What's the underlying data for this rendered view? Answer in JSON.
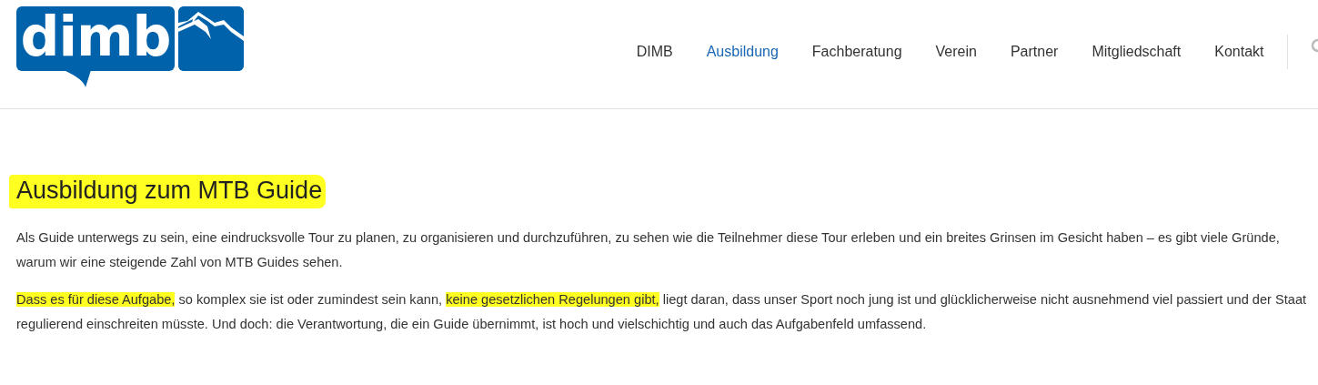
{
  "logo": {
    "text": "dimb"
  },
  "nav": [
    {
      "label": "DIMB",
      "selected": false
    },
    {
      "label": "Ausbildung",
      "selected": true
    },
    {
      "label": "Fachberatung",
      "selected": false
    },
    {
      "label": "Verein",
      "selected": false
    },
    {
      "label": "Partner",
      "selected": false
    },
    {
      "label": "Mitgliedschaft",
      "selected": false
    },
    {
      "label": "Kontakt",
      "selected": false
    }
  ],
  "heading": {
    "text": "Ausbildung zum MTB Guide",
    "highlighted": true
  },
  "paragraphs": [
    [
      {
        "text": "Als Guide unterwegs zu sein, eine eindrucksvolle Tour zu planen, zu organisieren und durchzuführen, zu sehen wie die Teilnehmer diese Tour erleben und ein breites Grinsen im Gesicht haben – es gibt viele Gründe, warum wir eine steigende Zahl von MTB Guides sehen.",
        "highlighted": false
      }
    ],
    [
      {
        "text": "Dass es für diese Aufgabe,",
        "highlighted": true
      },
      {
        "text": " so komplex sie ist oder zumindest sein kann, ",
        "highlighted": false
      },
      {
        "text": "keine gesetzlichen Regelungen gibt,",
        "highlighted": true
      },
      {
        "text": " liegt daran, dass unser Sport noch jung ist und glücklicherweise nicht ausnehmend viel passiert und der Staat regulierend einschreiten müsste. Und doch: die Verantwortung, die ein Guide übernimmt, ist hoch und vielschichtig und auch das Aufgabenfeld umfassend.",
        "highlighted": false
      }
    ]
  ]
}
